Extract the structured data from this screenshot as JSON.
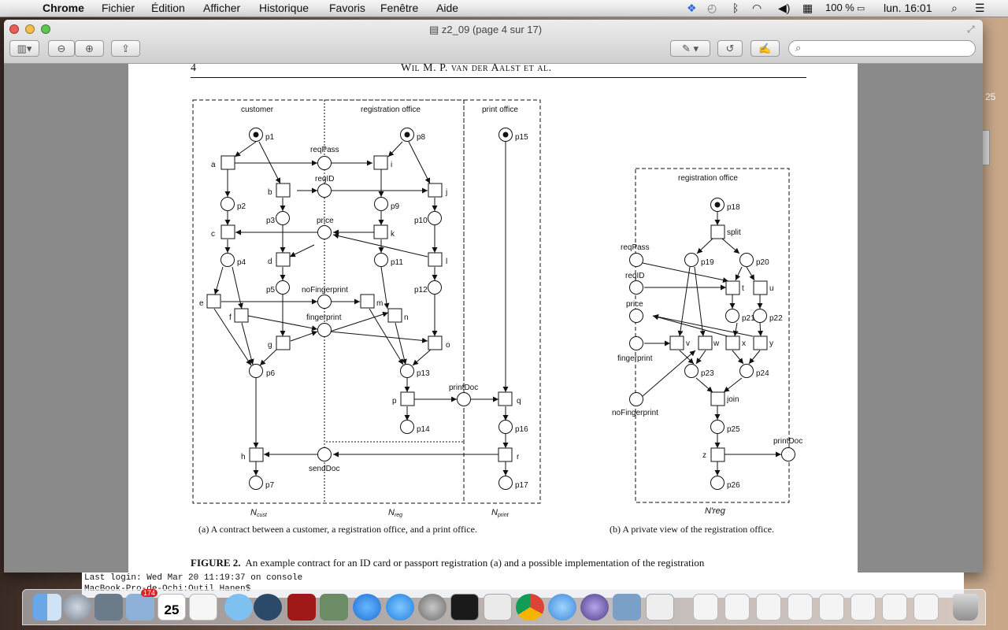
{
  "menubar": {
    "app": "Chrome",
    "menus": [
      "Fichier",
      "Édition",
      "Afficher",
      "Historique",
      "Favoris",
      "Fenêtre",
      "Aide"
    ],
    "battery": "100 %",
    "clock": "lun. 16:01"
  },
  "window": {
    "title": "z2_09 (page 4 sur 17)"
  },
  "page": {
    "page_number": "4",
    "header": "Wil M. P. van der Aalst et al.",
    "caption_a": "(a) A contract between a customer, a registration office, and a print office.",
    "caption_b": "(b) A private view of the registration office.",
    "figure_label": "FIGURE 2.",
    "figure_text": "An example contract for an ID card or passport registration (a) and a possible implementation of the registration"
  },
  "figure_a": {
    "regions": [
      "customer",
      "registration office",
      "print office"
    ],
    "net_labels": [
      "N",
      "cust",
      "N",
      "reg",
      "N",
      "print"
    ],
    "places": [
      "p1",
      "p2",
      "p3",
      "p4",
      "p5",
      "p6",
      "p7",
      "p8",
      "p9",
      "p10",
      "p11",
      "p12",
      "p13",
      "p14",
      "p15",
      "p16",
      "p17"
    ],
    "channels": [
      "reqPass",
      "reqID",
      "price",
      "noFingerprint",
      "fingerprint",
      "printDoc",
      "sendDoc"
    ],
    "transitions": [
      "a",
      "b",
      "c",
      "d",
      "e",
      "f",
      "g",
      "h",
      "i",
      "j",
      "k",
      "l",
      "m",
      "n",
      "o",
      "p",
      "q",
      "r"
    ]
  },
  "figure_b": {
    "region": "registration office",
    "net_label": "N′reg",
    "places": [
      "p18",
      "p19",
      "p20",
      "p21",
      "p22",
      "p23",
      "p24",
      "p25",
      "p26"
    ],
    "channels": [
      "reqPass",
      "reqID",
      "price",
      "fingerprint",
      "noFingerprint",
      "printDoc"
    ],
    "transitions": [
      "split",
      "t",
      "u",
      "v",
      "w",
      "x",
      "y",
      "join",
      "z"
    ]
  },
  "terminal": {
    "line1": "Last login: Wed Mar 20 11:19:37 on console",
    "line2": "MacBook-Pro-de-Ochi:Outil Hanen$"
  },
  "dock": {
    "calendar_day": "25",
    "mail_badge": "174"
  },
  "desktop_label": "25"
}
